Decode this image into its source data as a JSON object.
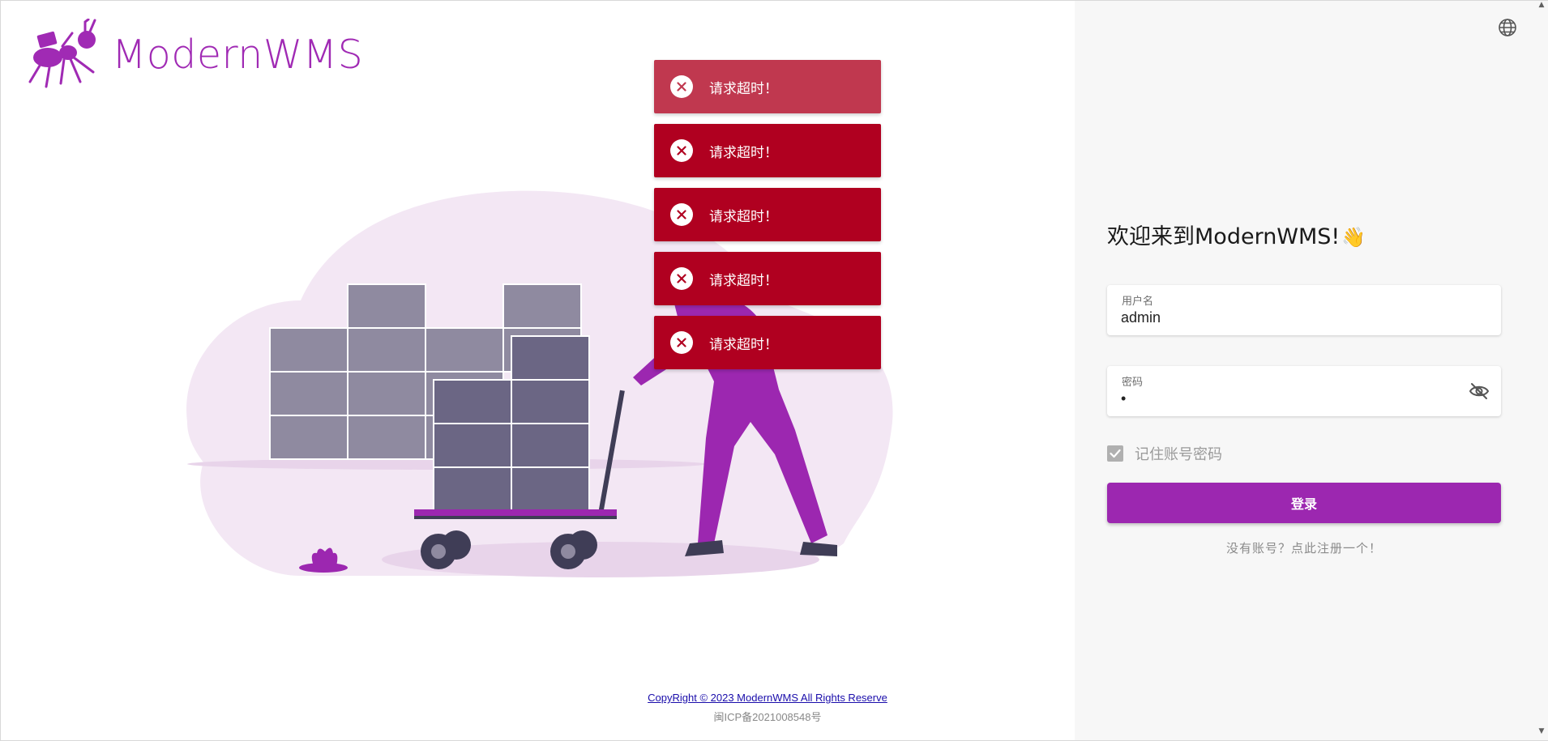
{
  "brand": {
    "name": "ModernWMS",
    "color": "#a02ab4",
    "logo_icon": "ant-logo-icon"
  },
  "toasts": [
    {
      "message": "请求超时！",
      "icon": "close-circle-icon"
    },
    {
      "message": "请求超时！",
      "icon": "close-circle-icon"
    },
    {
      "message": "请求超时！",
      "icon": "close-circle-icon"
    },
    {
      "message": "请求超时！",
      "icon": "close-circle-icon"
    },
    {
      "message": "请求超时！",
      "icon": "close-circle-icon"
    }
  ],
  "footer": {
    "copyright": "CopyRight © 2023 ModernWMS All Rights Reserve",
    "icp": "闽ICP备2021008548号"
  },
  "login": {
    "welcome": "欢迎来到ModernWMS!",
    "welcome_emoji": "👋",
    "username": {
      "label": "用户名",
      "value": "admin"
    },
    "password": {
      "label": "密码",
      "value": "•"
    },
    "remember_label": "记住账号密码",
    "remember_checked": true,
    "submit_label": "登录",
    "register_link": "没有账号？点此注册一个！"
  },
  "colors": {
    "primary": "#9c27b0",
    "error": "#b00020",
    "panel_bg": "#f7f7f7"
  },
  "icons": {
    "language": "globe-icon",
    "password_visibility": "eye-off-icon"
  }
}
